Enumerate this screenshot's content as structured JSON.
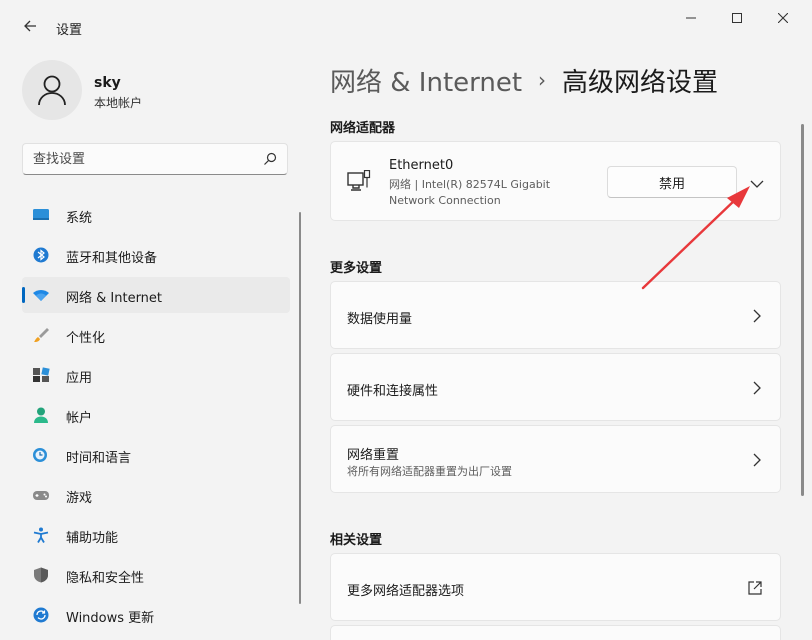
{
  "app": {
    "title": "设置",
    "back_icon": "back-arrow-icon"
  },
  "window_controls": {
    "minimize": "minimize-icon",
    "maximize": "maximize-icon",
    "close": "close-icon"
  },
  "user": {
    "name": "sky",
    "account_type": "本地帐户"
  },
  "search": {
    "placeholder": "查找设置"
  },
  "sidebar": {
    "items": [
      {
        "label": "系统",
        "icon": "system-icon"
      },
      {
        "label": "蓝牙和其他设备",
        "icon": "bluetooth-icon"
      },
      {
        "label": "网络 & Internet",
        "icon": "wifi-icon",
        "active": true
      },
      {
        "label": "个性化",
        "icon": "brush-icon"
      },
      {
        "label": "应用",
        "icon": "apps-icon"
      },
      {
        "label": "帐户",
        "icon": "account-icon"
      },
      {
        "label": "时间和语言",
        "icon": "time-language-icon"
      },
      {
        "label": "游戏",
        "icon": "gamepad-icon"
      },
      {
        "label": "辅助功能",
        "icon": "accessibility-icon"
      },
      {
        "label": "隐私和安全性",
        "icon": "shield-icon"
      },
      {
        "label": "Windows 更新",
        "icon": "windows-update-icon"
      }
    ]
  },
  "breadcrumb": {
    "parent": "网络 & Internet",
    "separator": "›",
    "current": "高级网络设置"
  },
  "adapters_section": {
    "title": "网络适配器",
    "adapter": {
      "name": "Ethernet0",
      "description": "网络 | Intel(R) 82574L Gigabit Network Connection",
      "disable_label": "禁用"
    }
  },
  "more_section": {
    "title": "更多设置",
    "items": [
      {
        "title": "数据使用量"
      },
      {
        "title": "硬件和连接属性"
      },
      {
        "title": "网络重置",
        "subtitle": "将所有网络适配器重置为出厂设置"
      }
    ]
  },
  "related_section": {
    "title": "相关设置",
    "items": [
      {
        "title": "更多网络适配器选项",
        "icon": "external-link-icon"
      }
    ]
  },
  "colors": {
    "accent": "#0067c0",
    "annotation_arrow": "#e8383b",
    "background": "#f3f3f3"
  }
}
